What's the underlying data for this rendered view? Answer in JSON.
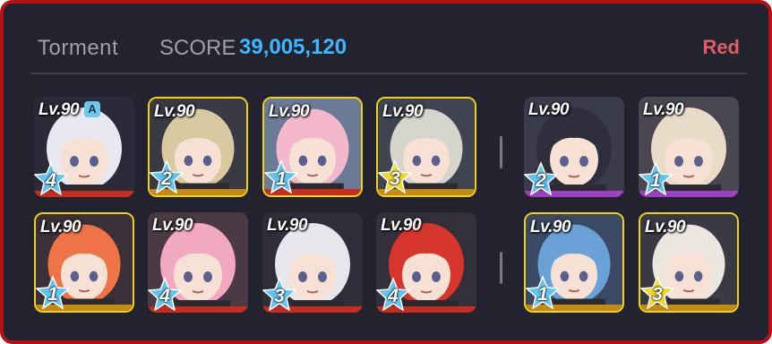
{
  "header": {
    "difficulty": "Torment",
    "score_label": "SCORE",
    "score_value": "39,005,120",
    "team_label": "Red"
  },
  "colors": {
    "frame": "#b31018",
    "panel": "#23232f",
    "score": "#3db7ff",
    "team": "#e25c66",
    "frame_highlight": "#f0d21a"
  },
  "students": [
    {
      "level": "Lv.90",
      "badge": "A",
      "stars": "4",
      "star_color": "blue",
      "bar_color": "#c62d1f",
      "highlight": false,
      "hair": "#e8e8f0",
      "bg": "#2a2a38"
    },
    {
      "level": "Lv.90",
      "badge": "",
      "stars": "2",
      "star_color": "blue",
      "bar_color": "#c58a14",
      "highlight": true,
      "hair": "#d9c9a0",
      "bg": "#393a44"
    },
    {
      "level": "Lv.90",
      "badge": "",
      "stars": "1",
      "star_color": "blue",
      "bar_color": "#c62d1f",
      "highlight": true,
      "hair": "#f4b8cc",
      "bg": "#6b7a96"
    },
    {
      "level": "Lv.90",
      "badge": "",
      "stars": "3",
      "star_color": "yellow",
      "bar_color": "#c58a14",
      "highlight": true,
      "hair": "#d5d5cc",
      "bg": "#3f4450"
    },
    {
      "level": "Lv.90",
      "badge": "",
      "stars": "2",
      "star_color": "blue",
      "bar_color": "#9c3fc0",
      "highlight": false,
      "hair": "#2e2e3c",
      "bg": "#3a3c4c"
    },
    {
      "level": "Lv.90",
      "badge": "",
      "stars": "1",
      "star_color": "blue",
      "bar_color": "#9c3fc0",
      "highlight": false,
      "hair": "#e8dcc8",
      "bg": "#4a4750"
    },
    {
      "level": "Lv.90",
      "badge": "",
      "stars": "1",
      "star_color": "blue",
      "bar_color": "#c58a14",
      "highlight": true,
      "hair": "#ee7448",
      "bg": "#3a3038"
    },
    {
      "level": "Lv.90",
      "badge": "",
      "stars": "4",
      "star_color": "blue",
      "bar_color": "#c62d1f",
      "highlight": false,
      "hair": "#f2a8c0",
      "bg": "#4a3a44"
    },
    {
      "level": "Lv.90",
      "badge": "",
      "stars": "3",
      "star_color": "blue",
      "bar_color": "#c62d1f",
      "highlight": false,
      "hair": "#e6e6ec",
      "bg": "#2e2e3a"
    },
    {
      "level": "Lv.90",
      "badge": "",
      "stars": "4",
      "star_color": "blue",
      "bar_color": "#c62d1f",
      "highlight": false,
      "hair": "#d6352c",
      "bg": "#34303a"
    },
    {
      "level": "Lv.90",
      "badge": "",
      "stars": "1",
      "star_color": "blue",
      "bar_color": "#c58a14",
      "highlight": true,
      "hair": "#6aa2d8",
      "bg": "#3a4a64"
    },
    {
      "level": "Lv.90",
      "badge": "",
      "stars": "3",
      "star_color": "yellow",
      "bar_color": "#c58a14",
      "highlight": true,
      "hair": "#ece6e0",
      "bg": "#3a3a44"
    }
  ]
}
